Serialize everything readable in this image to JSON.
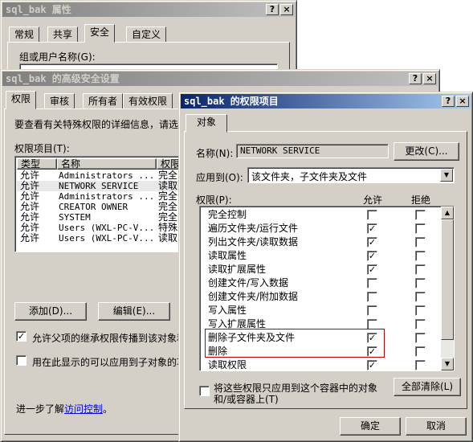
{
  "props_window": {
    "title": "sql_bak 属性",
    "tabs": [
      "常规",
      "共享",
      "安全",
      "自定义"
    ],
    "group_label": "组或用户名称(G):"
  },
  "adv_window": {
    "title": "sql_bak 的高级安全设置",
    "tabs": [
      "权限",
      "审核",
      "所有者",
      "有效权限"
    ],
    "intro": "要查看有关特殊权限的详细信息，请选",
    "entries_label": "权限项目(T):",
    "columns": [
      "类型",
      "名称",
      "权限"
    ],
    "rows": [
      {
        "type": "允许",
        "name": "Administrators ...",
        "perm": "完全"
      },
      {
        "type": "允许",
        "name": "NETWORK SERVICE",
        "perm": "读取"
      },
      {
        "type": "允许",
        "name": "Administrators ...",
        "perm": "完全"
      },
      {
        "type": "允许",
        "name": "CREATOR OWNER",
        "perm": "完全"
      },
      {
        "type": "允许",
        "name": "SYSTEM",
        "perm": "完全"
      },
      {
        "type": "允许",
        "name": "Users (WXL-PC-V...",
        "perm": "特殊"
      },
      {
        "type": "允许",
        "name": "Users (WXL-PC-V...",
        "perm": "读取"
      }
    ],
    "add_button": "添加(D)...",
    "edit_button": "编辑(E)...",
    "inherit_label": "允许父项的继承权限传播到该对象和",
    "replace_label": "用在此显示的可以应用到子对象的项",
    "more_text": "进一步了解",
    "more_link": "访问控制",
    "more_end": "。"
  },
  "perm_window": {
    "title": "sql_bak 的权限项目",
    "tab": "对象",
    "name_label": "名称(N):",
    "name_value": "NETWORK SERVICE",
    "change_button": "更改(C)...",
    "apply_label": "应用到(O):",
    "apply_value": "该文件夹，子文件夹及文件",
    "perms_label": "权限(P):",
    "allow_header": "允许",
    "deny_header": "拒绝",
    "permissions": [
      {
        "name": "完全控制",
        "allow": false,
        "deny": false
      },
      {
        "name": "遍历文件夹/运行文件",
        "allow": true,
        "deny": false
      },
      {
        "name": "列出文件夹/读取数据",
        "allow": true,
        "deny": false
      },
      {
        "name": "读取属性",
        "allow": true,
        "deny": false
      },
      {
        "name": "读取扩展属性",
        "allow": true,
        "deny": false
      },
      {
        "name": "创建文件/写入数据",
        "allow": false,
        "deny": false
      },
      {
        "name": "创建文件夹/附加数据",
        "allow": false,
        "deny": false
      },
      {
        "name": "写入属性",
        "allow": false,
        "deny": false
      },
      {
        "name": "写入扩展属性",
        "allow": false,
        "deny": false
      },
      {
        "name": "删除子文件夹及文件",
        "allow": true,
        "deny": false
      },
      {
        "name": "删除",
        "allow": true,
        "deny": false
      },
      {
        "name": "读取权限",
        "allow": true,
        "deny": false
      }
    ],
    "apply_only_label_1": "将这些权限只应用到这个容器中的对象",
    "apply_only_label_2": "和/或容器上(T)",
    "clear_all_button": "全部清除(L)",
    "ok_button": "确定",
    "cancel_button": "取消"
  },
  "titlebar_buttons": {
    "help": "?",
    "close": "×"
  },
  "highlight_color": "#c00000"
}
